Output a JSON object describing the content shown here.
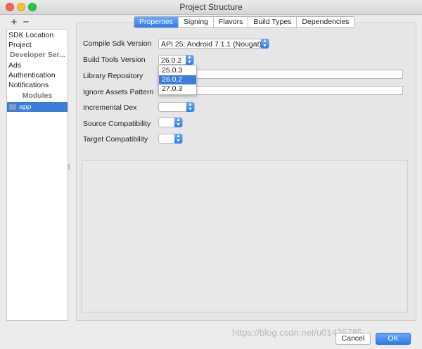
{
  "window": {
    "title": "Project Structure"
  },
  "toolbar": {
    "add_label": "+",
    "remove_label": "−"
  },
  "sidebar": {
    "items": [
      "SDK Location",
      "Project"
    ],
    "developer_header": "Developer Ser...",
    "more_items": [
      "Ads",
      "Authentication",
      "Notifications"
    ],
    "modules_header": "Modules",
    "module": "app"
  },
  "tabs": [
    "Properties",
    "Signing",
    "Flavors",
    "Build Types",
    "Dependencies"
  ],
  "active_tab": "Properties",
  "form": {
    "compile_sdk_label": "Compile Sdk Version",
    "compile_sdk_value": "API 25: Android 7.1.1 (Nougat)",
    "build_tools_label": "Build Tools Version",
    "build_tools_value": "26.0.2",
    "library_repo_label": "Library Repository",
    "ignore_assets_label": "Ignore Assets Pattern",
    "incremental_dex_label": "Incremental Dex",
    "source_compat_label": "Source Compatibility",
    "target_compat_label": "Target Compatibility"
  },
  "build_tools_options": [
    "25.0.3",
    "26.0.2",
    "27.0.3"
  ],
  "build_tools_selected": "26.0.2",
  "buttons": {
    "cancel": "Cancel",
    "ok": "OK"
  },
  "watermark": "https://blog.csdn.net/u01425785",
  "colors": {
    "accent": "#3a7ed9",
    "close": "#fc5f57",
    "minimize": "#fdbc2e",
    "maximize": "#28c840"
  }
}
